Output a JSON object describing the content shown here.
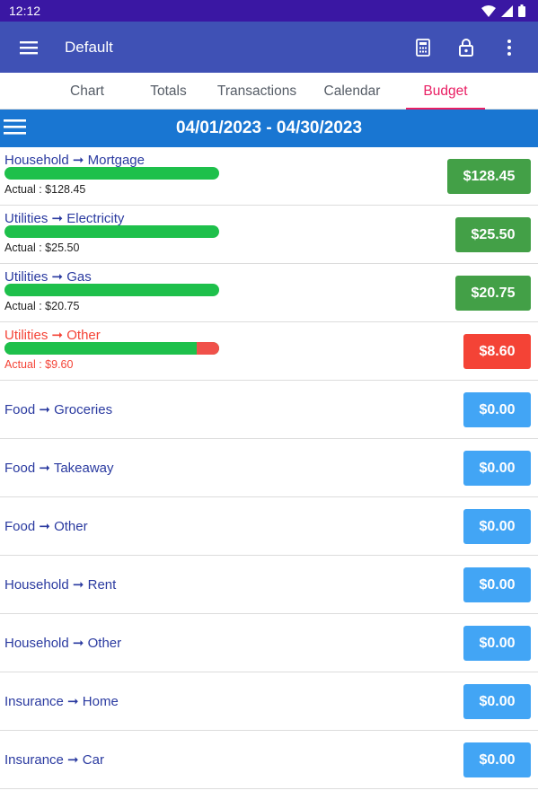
{
  "status_bar": {
    "time": "12:12"
  },
  "app_bar": {
    "title": "Default"
  },
  "tabs": [
    {
      "label": "Chart"
    },
    {
      "label": "Totals"
    },
    {
      "label": "Transactions"
    },
    {
      "label": "Calendar"
    },
    {
      "label": "Budget"
    }
  ],
  "date_range": "04/01/2023 - 04/30/2023",
  "budget_rows": [
    {
      "label": "Household ➞ Mortgage",
      "actual": "Actual : $128.45",
      "amount": "$128.45",
      "status": "green",
      "progress": 1.0
    },
    {
      "label": "Utilities ➞ Electricity",
      "actual": "Actual : $25.50",
      "amount": "$25.50",
      "status": "green",
      "progress": 1.0
    },
    {
      "label": "Utilities ➞ Gas",
      "actual": "Actual : $20.75",
      "amount": "$20.75",
      "status": "green",
      "progress": 1.0
    },
    {
      "label": "Utilities ➞ Other",
      "actual": "Actual : $9.60",
      "amount": "$8.60",
      "status": "red",
      "progress": 0.896
    },
    {
      "label": "Food ➞ Groceries",
      "amount": "$0.00",
      "status": "blue"
    },
    {
      "label": "Food ➞ Takeaway",
      "amount": "$0.00",
      "status": "blue"
    },
    {
      "label": "Food ➞ Other",
      "amount": "$0.00",
      "status": "blue"
    },
    {
      "label": "Household ➞ Rent",
      "amount": "$0.00",
      "status": "blue"
    },
    {
      "label": "Household ➞ Other",
      "amount": "$0.00",
      "status": "blue"
    },
    {
      "label": "Insurance ➞ Home",
      "amount": "$0.00",
      "status": "blue"
    },
    {
      "label": "Insurance ➞ Car",
      "amount": "$0.00",
      "status": "blue"
    }
  ],
  "colors": {
    "status_bar": "#3a17a3",
    "app_bar": "#3f51b5",
    "date_bar": "#1976d2",
    "accent": "#e91e63",
    "green": "#43a047",
    "red": "#f44336",
    "blue": "#42a5f5"
  }
}
